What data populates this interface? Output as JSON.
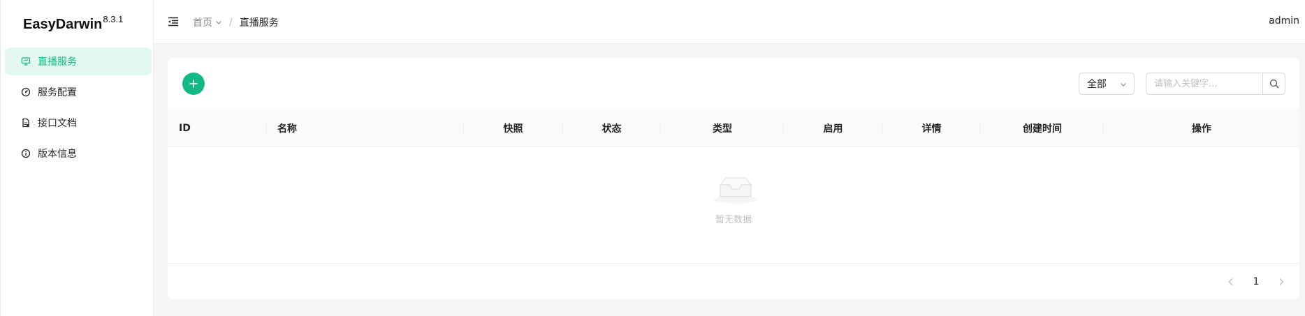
{
  "app": {
    "name": "EasyDarwin",
    "version": "8.3.1"
  },
  "sidebar": {
    "items": [
      {
        "label": "直播服务",
        "icon": "monitor-icon",
        "active": true
      },
      {
        "label": "服务配置",
        "icon": "gauge-icon",
        "active": false
      },
      {
        "label": "接口文档",
        "icon": "document-icon",
        "active": false
      },
      {
        "label": "版本信息",
        "icon": "info-icon",
        "active": false
      }
    ]
  },
  "header": {
    "breadcrumb": {
      "home": "首页",
      "separator": "/",
      "current": "直播服务"
    },
    "user": "admin"
  },
  "toolbar": {
    "filter_value": "全部",
    "search_placeholder": "请输入关键字..."
  },
  "table": {
    "columns": [
      "ID",
      "名称",
      "快照",
      "状态",
      "类型",
      "启用",
      "详情",
      "创建时间",
      "操作"
    ],
    "rows": [],
    "empty_text": "暂无数据"
  },
  "pagination": {
    "current_page": "1"
  },
  "colors": {
    "accent": "#14b886",
    "active_bg": "#e3f8ef"
  }
}
